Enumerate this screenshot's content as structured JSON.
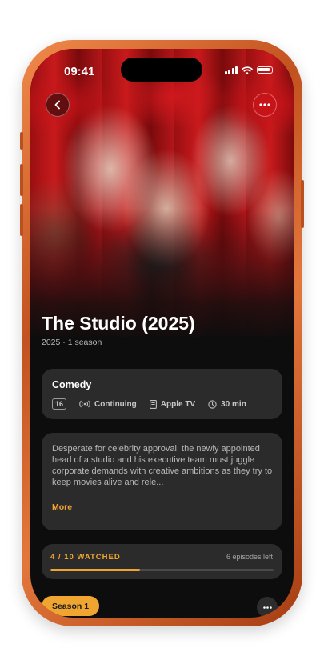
{
  "status_bar": {
    "time": "09:41"
  },
  "hero": {
    "image_subject": "theater-audience-photo"
  },
  "show": {
    "title": "The Studio (2025)",
    "subtitle": "2025 · 1 season"
  },
  "details": {
    "genre": "Comedy",
    "rating": "16",
    "status": "Continuing",
    "network": "Apple TV",
    "runtime": "30 min"
  },
  "description": {
    "text": "Desperate for celebrity approval, the newly appointed head of a studio and his executive team must juggle corporate demands with creative ambitions as they try to keep movies alive and rele...",
    "more_label": "More"
  },
  "progress": {
    "watched_label": "4 / 10 WATCHED",
    "remaining_label": "6 episodes left",
    "watched_fraction": 0.4
  },
  "season": {
    "selected_label": "Season 1"
  },
  "colors": {
    "accent": "#f0a531",
    "card_background": "#2b2b2b",
    "screen_background": "#0d0d0d",
    "device_frame": "#c2521f"
  },
  "icons": {
    "back": "chevron-left-icon",
    "options": "ellipsis-icon",
    "status": "broadcast-icon",
    "network": "document-icon",
    "runtime": "clock-icon"
  }
}
